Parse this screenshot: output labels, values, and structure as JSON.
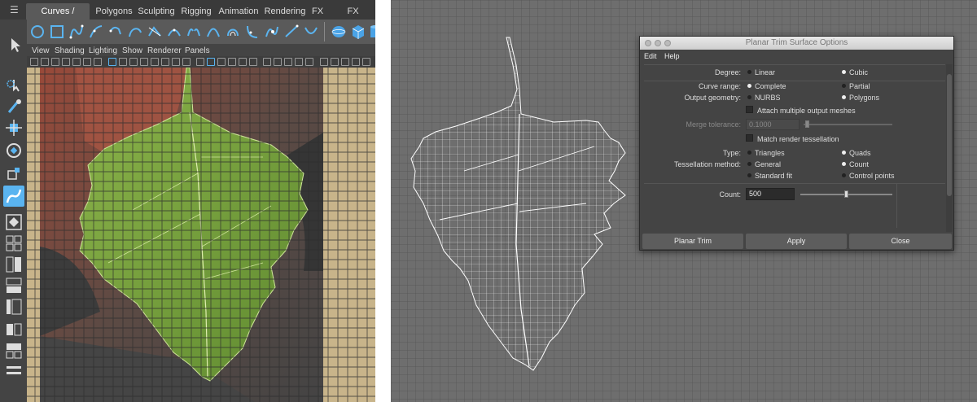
{
  "shelf": {
    "tabs": [
      "Curves / Surfaces",
      "Polygons",
      "Sculpting",
      "Rigging",
      "Animation",
      "Rendering",
      "FX",
      "FX Caching"
    ],
    "active_tab": "Curves / Surfaces"
  },
  "viewport_menu": [
    "View",
    "Shading",
    "Lighting",
    "Show",
    "Renderer",
    "Panels"
  ],
  "dialog": {
    "title": "Planar Trim Surface Options",
    "menu": [
      "Edit",
      "Help"
    ],
    "degree": {
      "label": "Degree:",
      "options": [
        "Linear",
        "Cubic"
      ],
      "selected": "Cubic"
    },
    "curve_range": {
      "label": "Curve range:",
      "options": [
        "Complete",
        "Partial"
      ],
      "selected": "Complete"
    },
    "output_geometry": {
      "label": "Output geometry:",
      "options": [
        "NURBS",
        "Polygons"
      ],
      "selected": "Polygons"
    },
    "attach_multiple": {
      "label": "Attach multiple output meshes",
      "checked": false
    },
    "merge_tolerance": {
      "label": "Merge tolerance:",
      "value": "0.1000"
    },
    "match_render": {
      "label": "Match render tessellation",
      "checked": false
    },
    "type": {
      "label": "Type:",
      "options": [
        "Triangles",
        "Quads"
      ],
      "selected": "Quads"
    },
    "tessellation_method": {
      "label": "Tessellation method:",
      "options": [
        "General",
        "Count",
        "Standard fit",
        "Control points"
      ],
      "selected": "Count"
    },
    "count": {
      "label": "Count:",
      "value": "500",
      "slider_fraction": 0.5
    },
    "buttons": {
      "planar_trim": "Planar Trim",
      "apply": "Apply",
      "close": "Close"
    }
  },
  "colors": {
    "leaf": "#7aa542",
    "grid_line": "#3a3a3a",
    "viewport_bg": "#6e6e6e",
    "dialog_bg": "#444444"
  }
}
